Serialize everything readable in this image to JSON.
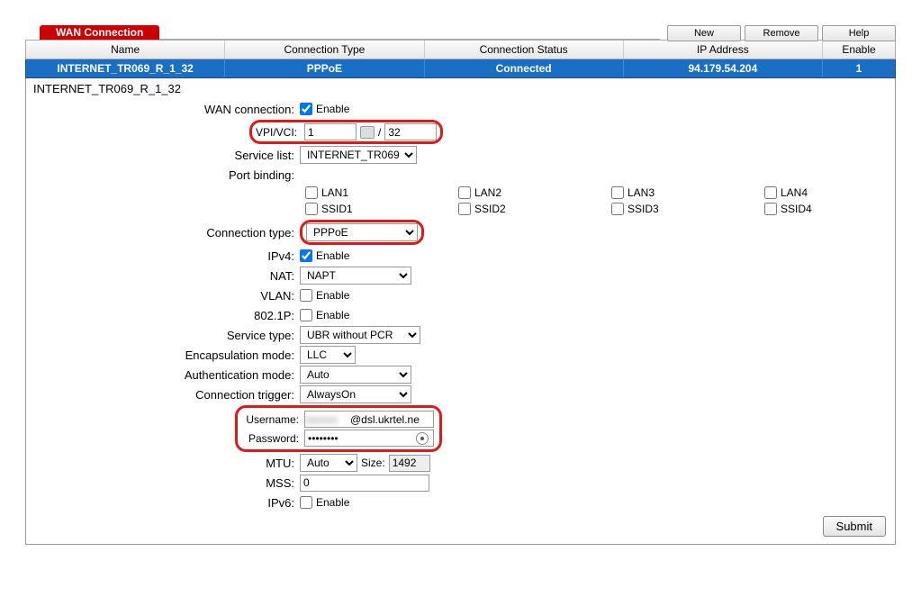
{
  "tabs": {
    "title": "WAN Connection"
  },
  "buttons": {
    "new": "New",
    "remove": "Remove",
    "help": "Help",
    "submit": "Submit"
  },
  "grid": {
    "headers": {
      "name": "Name",
      "type": "Connection Type",
      "status": "Connection Status",
      "ip": "IP Address",
      "enable": "Enable"
    },
    "row": {
      "name": "INTERNET_TR069_R_1_32",
      "type": "PPPoE",
      "status": "Connected",
      "ip": "94.179.54.204",
      "enable": "1"
    }
  },
  "section_title": "INTERNET_TR069_R_1_32",
  "labels": {
    "wan_connection": "WAN connection:",
    "vpi_vci": "VPI/VCI:",
    "service_list": "Service list:",
    "port_binding": "Port binding:",
    "connection_type": "Connection type:",
    "ipv4": "IPv4:",
    "nat": "NAT:",
    "vlan": "VLAN:",
    "p8021": "802.1P:",
    "service_type": "Service type:",
    "encap_mode": "Encapsulation mode:",
    "auth_mode": "Authentication mode:",
    "conn_trigger": "Connection trigger:",
    "username": "Username:",
    "password": "Password:",
    "mtu": "MTU:",
    "size": "Size:",
    "mss": "MSS:",
    "ipv6": "IPv6:"
  },
  "values": {
    "enable_text": "Enable",
    "vpi": "1",
    "vci": "32",
    "slash": "/",
    "service_list": "INTERNET_TR069",
    "connection_type": "PPPoE",
    "nat": "NAPT",
    "service_type": "UBR without PCR",
    "encap_mode": "LLC",
    "auth_mode": "Auto",
    "conn_trigger": "AlwaysOn",
    "username_suffix": "@dsl.ukrtel.ne",
    "password": "••••••••",
    "mtu": "Auto",
    "mtu_size": "1492",
    "mss": "0"
  },
  "ports": {
    "lan1": "LAN1",
    "lan2": "LAN2",
    "lan3": "LAN3",
    "lan4": "LAN4",
    "ssid1": "SSID1",
    "ssid2": "SSID2",
    "ssid3": "SSID3",
    "ssid4": "SSID4"
  },
  "checks": {
    "wan_enable": true,
    "ipv4_enable": true,
    "vlan_enable": false,
    "p8021_enable": false,
    "ipv6_enable": false,
    "lan1": false,
    "lan2": false,
    "lan3": false,
    "lan4": false,
    "ssid1": false,
    "ssid2": false,
    "ssid3": false,
    "ssid4": false
  }
}
